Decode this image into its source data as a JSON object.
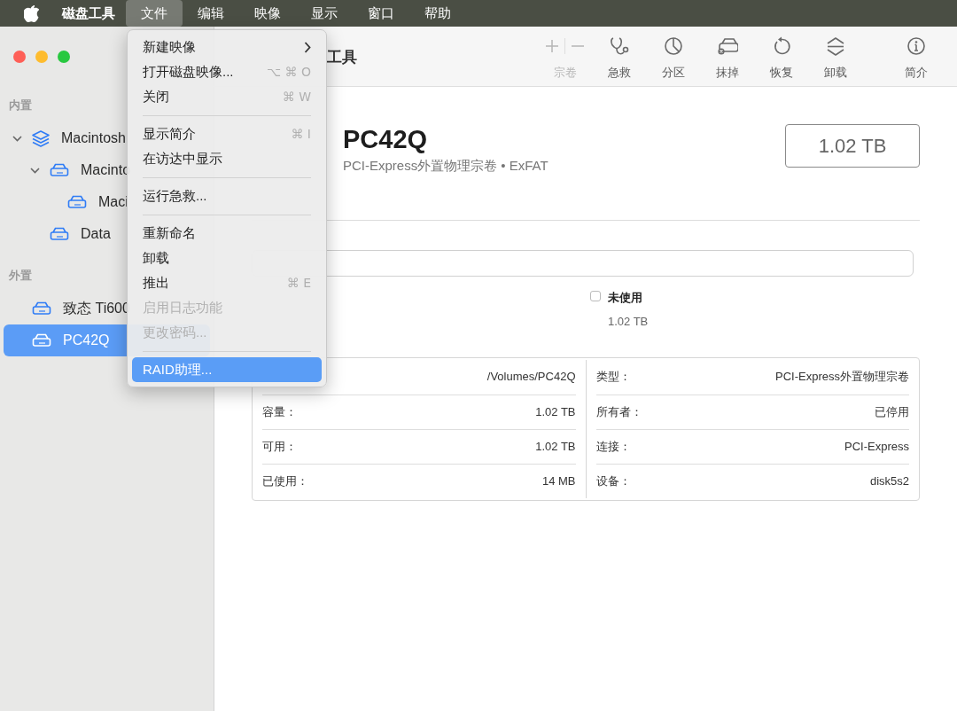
{
  "menu_bar": {
    "app_name": "磁盘工具",
    "menus": [
      {
        "label": "文件",
        "selected": true
      },
      {
        "label": "编辑",
        "selected": false
      },
      {
        "label": "映像",
        "selected": false
      },
      {
        "label": "显示",
        "selected": false
      },
      {
        "label": "窗口",
        "selected": false
      },
      {
        "label": "帮助",
        "selected": false
      }
    ]
  },
  "file_menu": {
    "items": [
      {
        "kind": "item",
        "label": "新建映像",
        "submenu": true,
        "disabled": false,
        "selected": false
      },
      {
        "kind": "item",
        "label": "打开磁盘映像...",
        "shortcut": "⌥ ⌘ O",
        "disabled": false,
        "selected": false
      },
      {
        "kind": "item",
        "label": "关闭",
        "shortcut": "⌘ W",
        "disabled": false,
        "selected": false
      },
      {
        "kind": "separator"
      },
      {
        "kind": "item",
        "label": "显示简介",
        "shortcut": "⌘ I",
        "disabled": false,
        "selected": false
      },
      {
        "kind": "item",
        "label": "在访达中显示",
        "disabled": false,
        "selected": false
      },
      {
        "kind": "separator"
      },
      {
        "kind": "item",
        "label": "运行急救...",
        "disabled": false,
        "selected": false
      },
      {
        "kind": "separator"
      },
      {
        "kind": "item",
        "label": "重新命名",
        "disabled": false,
        "selected": false
      },
      {
        "kind": "item",
        "label": "卸载",
        "disabled": false,
        "selected": false
      },
      {
        "kind": "item",
        "label": "推出",
        "shortcut": "⌘ E",
        "disabled": false,
        "selected": false
      },
      {
        "kind": "item",
        "label": "启用日志功能",
        "disabled": true,
        "selected": false
      },
      {
        "kind": "item",
        "label": "更改密码...",
        "disabled": true,
        "selected": false
      },
      {
        "kind": "separator"
      },
      {
        "kind": "item",
        "label": "RAID助理...",
        "disabled": false,
        "selected": true
      }
    ]
  },
  "sidebar": {
    "sections": [
      {
        "title": "内置",
        "items": [
          {
            "label": "Macintosh",
            "kind": "container",
            "expanded": true,
            "selected": false,
            "children": [
              {
                "label": "Macinto",
                "kind": "volume",
                "expanded": true,
                "selected": false,
                "children": [
                  {
                    "label": "Maci",
                    "kind": "volume",
                    "selected": false
                  }
                ]
              },
              {
                "label": "Data",
                "kind": "volume",
                "selected": false
              }
            ]
          }
        ]
      },
      {
        "title": "外置",
        "items": [
          {
            "label": "致态 Ti600",
            "kind": "volume",
            "selected": false
          },
          {
            "label": "PC42Q",
            "kind": "volume",
            "selected": true
          }
        ]
      }
    ]
  },
  "window": {
    "title": "工具"
  },
  "toolbar": {
    "items": [
      {
        "kind": "add_remove",
        "label": "宗卷",
        "disabled": true
      },
      {
        "kind": "first_aid",
        "label": "急救",
        "disabled": false
      },
      {
        "kind": "partition",
        "label": "分区",
        "disabled": false
      },
      {
        "kind": "erase",
        "label": "抹掉",
        "disabled": false
      },
      {
        "kind": "restore",
        "label": "恢复",
        "disabled": false
      },
      {
        "kind": "unmount",
        "label": "卸载",
        "disabled": false
      },
      {
        "kind": "info",
        "label": "简介",
        "disabled": false
      }
    ]
  },
  "volume": {
    "name": "PC42Q",
    "subtitle": "PCI-Express外置物理宗卷 • ExFAT",
    "size": "1.02 TB"
  },
  "usage": {
    "legend": [
      {
        "label": "未使用",
        "value": "1.02 TB"
      }
    ]
  },
  "info": {
    "left": [
      {
        "value": "/Volumes/PC42Q"
      },
      {
        "label": "容量：",
        "value": "1.02 TB"
      },
      {
        "label": "可用：",
        "value": "1.02 TB"
      },
      {
        "label": "已使用：",
        "value": "14 MB"
      }
    ],
    "right": [
      {
        "label": "类型：",
        "value": "PCI-Express外置物理宗卷"
      },
      {
        "label": "所有者：",
        "value": "已停用"
      },
      {
        "label": "连接：",
        "value": "PCI-Express"
      },
      {
        "label": "设备：",
        "value": "disk5s2"
      }
    ]
  }
}
